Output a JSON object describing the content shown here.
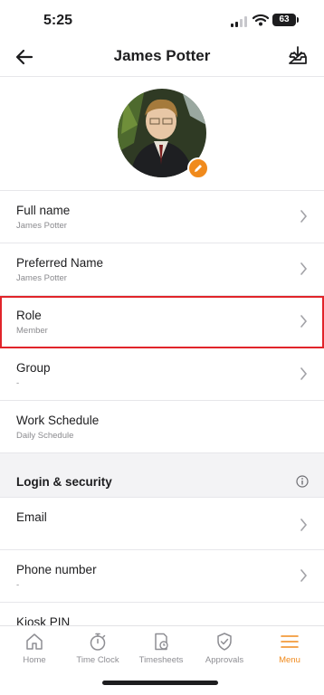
{
  "status": {
    "time": "5:25",
    "battery": "63"
  },
  "header": {
    "title": "James Potter",
    "back_icon": "back-arrow-icon",
    "action_icon": "inbox-download-icon"
  },
  "profile": {
    "avatar_desc": "profile photo",
    "edit_icon": "pencil-icon"
  },
  "rows": [
    {
      "label": "Full name",
      "value": "James Potter"
    },
    {
      "label": "Preferred Name",
      "value": "James Potter"
    },
    {
      "label": "Role",
      "value": "Member"
    },
    {
      "label": "Group",
      "value": "-"
    },
    {
      "label": "Work Schedule",
      "value": "Daily Schedule"
    }
  ],
  "security": {
    "title": "Login & security",
    "info_icon": "info-icon",
    "rows": [
      {
        "label": "Email",
        "value": ""
      },
      {
        "label": "Phone number",
        "value": "-"
      },
      {
        "label": "Kiosk PIN",
        "value": ""
      }
    ]
  },
  "tabs": [
    {
      "label": "Home",
      "icon": "home-icon"
    },
    {
      "label": "Time Clock",
      "icon": "stopwatch-icon"
    },
    {
      "label": "Timesheets",
      "icon": "timesheet-icon"
    },
    {
      "label": "Approvals",
      "icon": "shield-check-icon"
    },
    {
      "label": "Menu",
      "icon": "menu-icon",
      "active": true
    }
  ],
  "colors": {
    "accent": "#f08a1c",
    "highlight": "#e1242a"
  }
}
